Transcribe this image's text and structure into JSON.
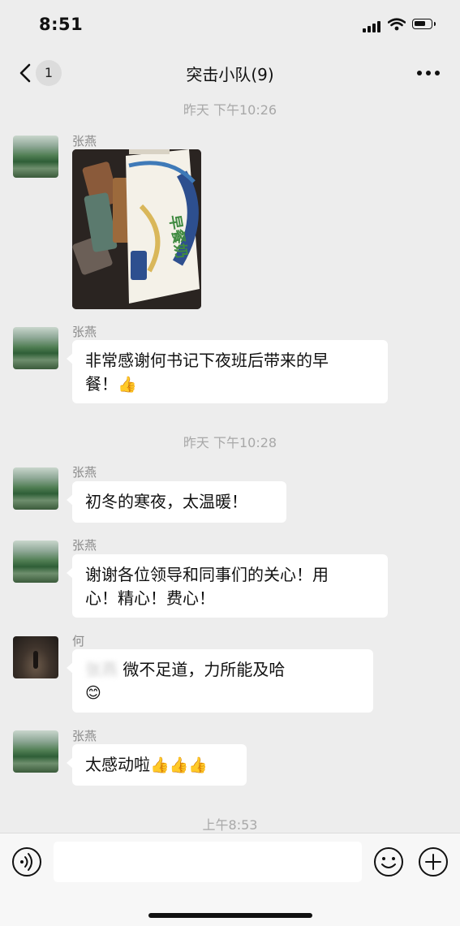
{
  "status_bar": {
    "time": "8:51",
    "battery_level": 0.7
  },
  "nav": {
    "back_count": "1",
    "title": "突击小队(9)"
  },
  "messages": [
    {
      "type": "timestamp",
      "text": "昨天 下午10:26"
    },
    {
      "type": "image",
      "sender": "张燕",
      "caption_text": "早餐奶"
    },
    {
      "type": "text",
      "sender": "张燕",
      "line1": "非常感谢何书记下夜班后带来的早",
      "line2": "餐！",
      "emoji": "👍"
    },
    {
      "type": "timestamp",
      "text": "昨天 下午10:28"
    },
    {
      "type": "text",
      "sender": "张燕",
      "line1": "初冬的寒夜，太温暖！"
    },
    {
      "type": "text",
      "sender": "张燕",
      "line1": "谢谢各位领导和同事们的关心！用",
      "line2": "心！精心！费心！"
    },
    {
      "type": "text",
      "sender": "何",
      "blurred": "张燕",
      "line1": "微不足道，力所能及哈",
      "emoji": "😊"
    },
    {
      "type": "text",
      "sender": "张燕",
      "line1": "太感动啦",
      "emoji": "👍👍👍"
    },
    {
      "type": "timestamp",
      "text": "上午8:53"
    }
  ],
  "input_bar": {
    "voice_icon": "voice-icon",
    "emoji_icon": "smiley-icon",
    "plus_icon": "plus-icon"
  }
}
